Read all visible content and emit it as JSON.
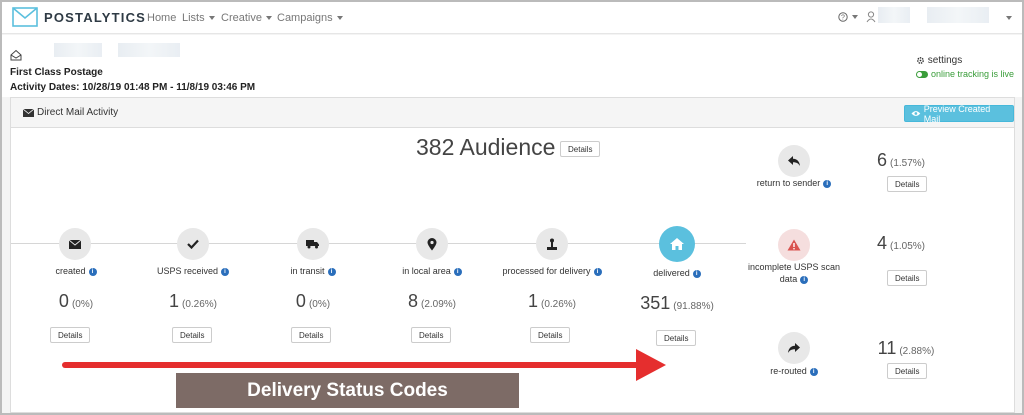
{
  "app": {
    "logo_text": "POSTALYTICS",
    "accent": "#5bc0de",
    "alert": "#e52e2e"
  },
  "nav": {
    "home": "Home",
    "lists": "Lists",
    "creative": "Creative",
    "campaigns": "Campaigns",
    "help": "?"
  },
  "header": {
    "postage": "First Class Postage",
    "dates": "Activity Dates: 10/28/19 01:48 PM - 11/8/19 03:46 PM",
    "settings": "settings",
    "online": "online tracking is live"
  },
  "panel": {
    "title": "Direct Mail Activity",
    "preview_button": "Preview Created Mail",
    "audience": "382 Audience",
    "details": "Details"
  },
  "steps": [
    {
      "icon": "envelope-icon",
      "label": "created",
      "count": "0",
      "pct": "(0%)"
    },
    {
      "icon": "check-icon",
      "label": "USPS received",
      "count": "1",
      "pct": "(0.26%)"
    },
    {
      "icon": "truck-icon",
      "label": "in transit",
      "count": "0",
      "pct": "(0%)"
    },
    {
      "icon": "map-marker-icon",
      "label": "in local area",
      "count": "8",
      "pct": "(2.09%)"
    },
    {
      "icon": "sorting-icon",
      "label": "processed for delivery",
      "count": "1",
      "pct": "(0.26%)"
    },
    {
      "icon": "home-icon",
      "label": "delivered",
      "count": "351",
      "pct": "(91.88%)"
    }
  ],
  "side": [
    {
      "icon": "reply-icon",
      "label": "return to sender",
      "count": "6",
      "pct": "(1.57%)"
    },
    {
      "icon": "warning-icon",
      "label": "incomplete USPS scan data",
      "count": "4",
      "pct": "(1.05%)"
    },
    {
      "icon": "forward-icon",
      "label": "re-routed",
      "count": "11",
      "pct": "(2.88%)"
    }
  ],
  "banner": "Delivery Status Codes"
}
